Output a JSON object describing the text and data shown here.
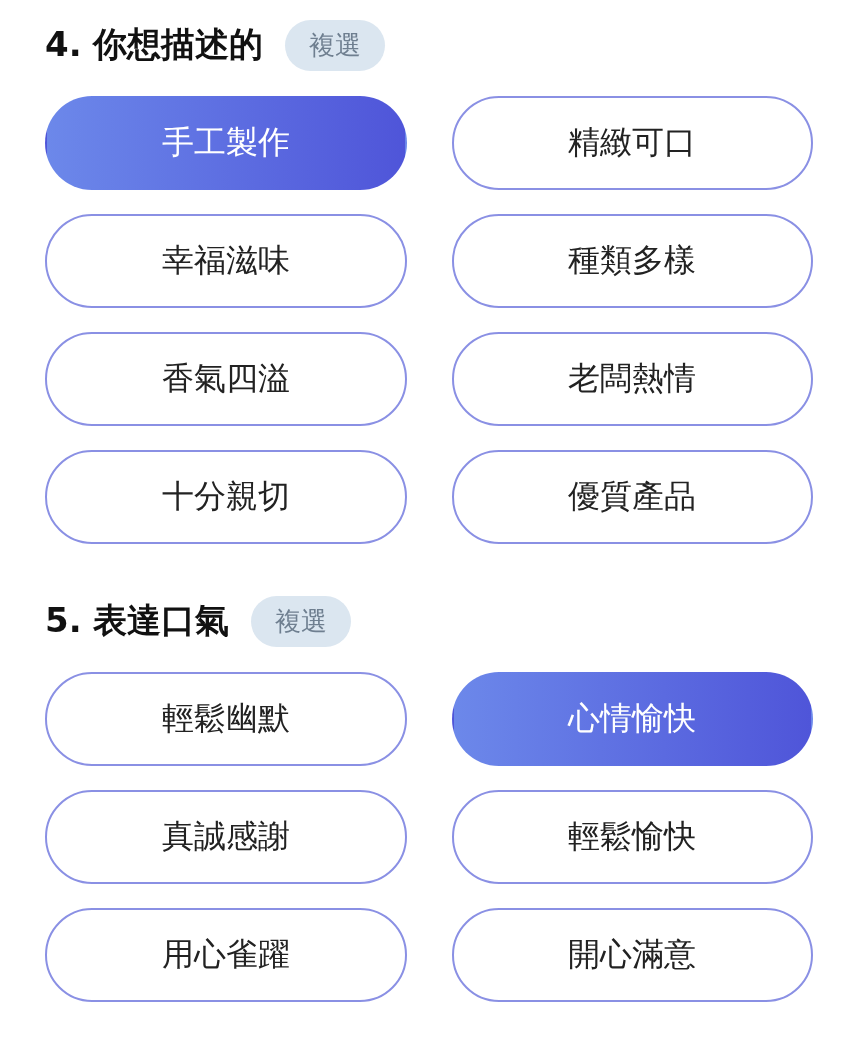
{
  "sections": [
    {
      "title": "4. 你想描述的",
      "badge": "複選",
      "options": [
        {
          "label": "手工製作",
          "selected": true
        },
        {
          "label": "精緻可口",
          "selected": false
        },
        {
          "label": "幸福滋味",
          "selected": false
        },
        {
          "label": "種類多樣",
          "selected": false
        },
        {
          "label": "香氣四溢",
          "selected": false
        },
        {
          "label": "老闆熱情",
          "selected": false
        },
        {
          "label": "十分親切",
          "selected": false
        },
        {
          "label": "優質產品",
          "selected": false
        }
      ]
    },
    {
      "title": "5. 表達口氣",
      "badge": "複選",
      "options": [
        {
          "label": "輕鬆幽默",
          "selected": false
        },
        {
          "label": "心情愉快",
          "selected": true
        },
        {
          "label": "真誠感謝",
          "selected": false
        },
        {
          "label": "輕鬆愉快",
          "selected": false
        },
        {
          "label": "用心雀躍",
          "selected": false
        },
        {
          "label": "開心滿意",
          "selected": false
        }
      ]
    }
  ]
}
